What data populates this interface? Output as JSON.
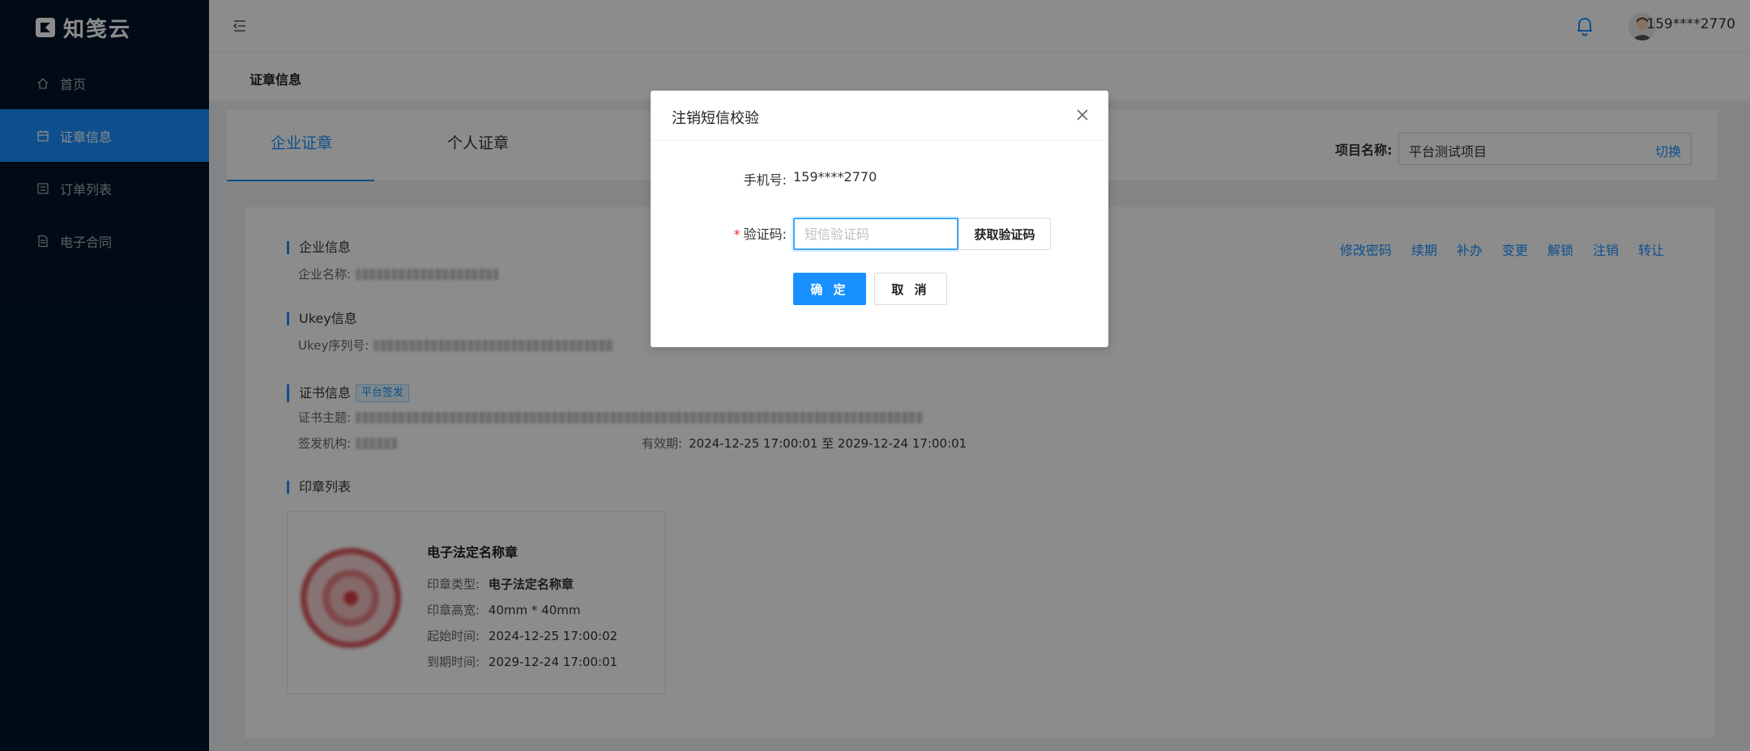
{
  "app": {
    "logo_text": "知笺云"
  },
  "sidebar": {
    "items": [
      {
        "label": "首页",
        "icon": "home-icon",
        "active": false
      },
      {
        "label": "证章信息",
        "icon": "calendar-icon",
        "active": true
      },
      {
        "label": "订单列表",
        "icon": "list-icon",
        "active": false
      },
      {
        "label": "电子合同",
        "icon": "contract-icon",
        "active": false
      }
    ]
  },
  "header": {
    "user_name": "159****2770",
    "icons": [
      "menu-fold-icon",
      "bell-icon",
      "avatar"
    ]
  },
  "breadcrumb": {
    "title": "证章信息"
  },
  "tabs": {
    "items": [
      {
        "label": "企业证章",
        "active": true
      },
      {
        "label": "个人证章",
        "active": false
      }
    ],
    "project_label": "项目名称:",
    "project_value": "平台测试项目",
    "project_switch": "切换"
  },
  "content": {
    "company_section": "企业信息",
    "company_name_label": "企业名称:",
    "ukey_section": "Ukey信息",
    "ukey_serial_label": "Ukey序列号:",
    "cert_section": "证书信息",
    "cert_badge": "平台签发",
    "cert_subject_label": "证书主题:",
    "issuer_label": "签发机构:",
    "validity_label": "有效期:",
    "validity_value": "2024-12-25 17:00:01 至 2029-12-24 17:00:01",
    "seal_section": "印章列表",
    "actions": [
      "修改密码",
      "续期",
      "补办",
      "变更",
      "解锁",
      "注销",
      "转让"
    ],
    "seal": {
      "name": "电子法定名称章",
      "type_label": "印章类型:",
      "type_value": "电子法定名称章",
      "size_label": "印章高宽:",
      "size_value": "40mm * 40mm",
      "start_label": "起始时间:",
      "start_value": "2024-12-25 17:00:02",
      "end_label": "到期时间:",
      "end_value": "2029-12-24 17:00:01"
    }
  },
  "modal": {
    "title": "注销短信校验",
    "phone_label": "手机号:",
    "phone_value": "159****2770",
    "code_label": "验证码:",
    "code_required_mark": "*",
    "code_placeholder": "短信验证码",
    "get_code_label": "获取验证码",
    "confirm_label": "确 定",
    "cancel_label": "取 消"
  },
  "colors": {
    "primary": "#1890ff",
    "sidebar_bg": "#001529",
    "required": "#f5222d"
  }
}
